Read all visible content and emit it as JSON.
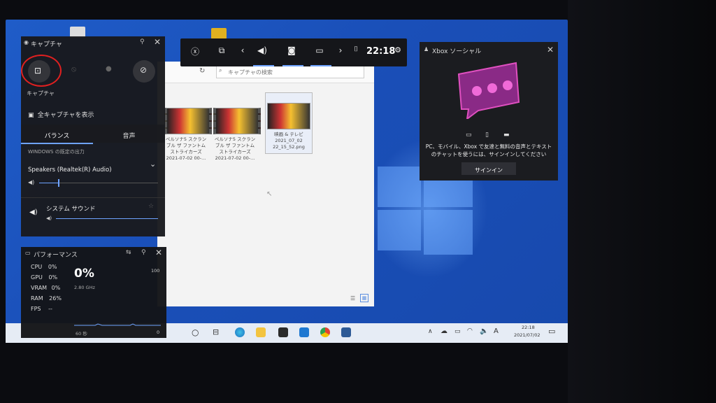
{
  "capture": {
    "title": "キャプチャ",
    "label": "キャプチャ",
    "show_all": "全キャプチャを表示"
  },
  "audio": {
    "tab_balance": "バランス",
    "tab_voice": "音声",
    "output_label": "WINDOWS の既定の出力",
    "device": "Speakers (Realtek(R) Audio)",
    "master_level": 0.16,
    "system_sound": "システム サウンド",
    "system_level": 1.0
  },
  "performance": {
    "title": "パフォーマンス",
    "cpu": "CPU",
    "cpu_val": "0%",
    "gpu": "GPU",
    "gpu_val": "0%",
    "vram": "VRAM",
    "vram_val": "0%",
    "ram": "RAM",
    "ram_val": "26%",
    "fps": "FPS",
    "fps_val": "--",
    "big_value": "0%",
    "freq": "2.80 GHz",
    "max": "100",
    "range_left": "60 秒",
    "range_right": "0"
  },
  "topbar": {
    "time": "22:18"
  },
  "social": {
    "title": "Xbox ソーシャル",
    "message": "PC、モバイル、Xbox で友達と無料の音声とテキストのチャットを使うには、サインインしてください",
    "signin": "サインイン"
  },
  "explorer": {
    "search_placeholder": "キャプチャの検索",
    "files": [
      {
        "name": "ペルソナ5 スクランブル ザ ファントム ストライカーズ 2021-07-02 00-..."
      },
      {
        "name": "ペルソナ5 スクランブル ザ ファントム ストライカーズ 2021-07-02 00-..."
      },
      {
        "name": "映画 & テレビ 2021_07_02 22_15_52.png"
      }
    ]
  },
  "taskbar": {
    "ime": "A",
    "clock_time": "22:18",
    "clock_date": "2021/07/02"
  }
}
